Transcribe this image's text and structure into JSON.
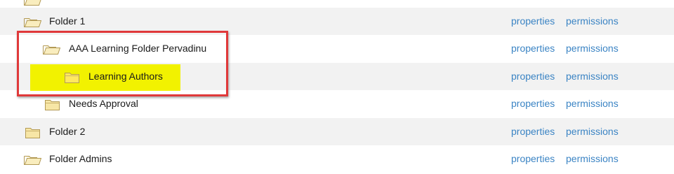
{
  "folders": [
    {
      "name": "Folder 1",
      "properties": "properties",
      "permissions": "permissions",
      "icon": "folder-open-icon"
    },
    {
      "name": "AAA Learning Folder Pervadinu",
      "properties": "properties",
      "permissions": "permissions",
      "icon": "folder-open-icon"
    },
    {
      "name": "Learning Authors",
      "properties": "properties",
      "permissions": "permissions",
      "icon": "folder-closed-icon"
    },
    {
      "name": "Needs Approval",
      "properties": "properties",
      "permissions": "permissions",
      "icon": "folder-closed-icon"
    },
    {
      "name": "Folder 2",
      "properties": "properties",
      "permissions": "permissions",
      "icon": "folder-closed-icon"
    },
    {
      "name": "Folder Admins",
      "properties": "properties",
      "permissions": "permissions",
      "icon": "folder-open-icon"
    }
  ],
  "colors": {
    "link": "#3b84c4",
    "row_shade": "#f2f2f2",
    "highlight": "#f2f200",
    "annotation_box": "#e0393a",
    "folder_fill": "#f7e6a6",
    "folder_stroke": "#b39a55"
  }
}
